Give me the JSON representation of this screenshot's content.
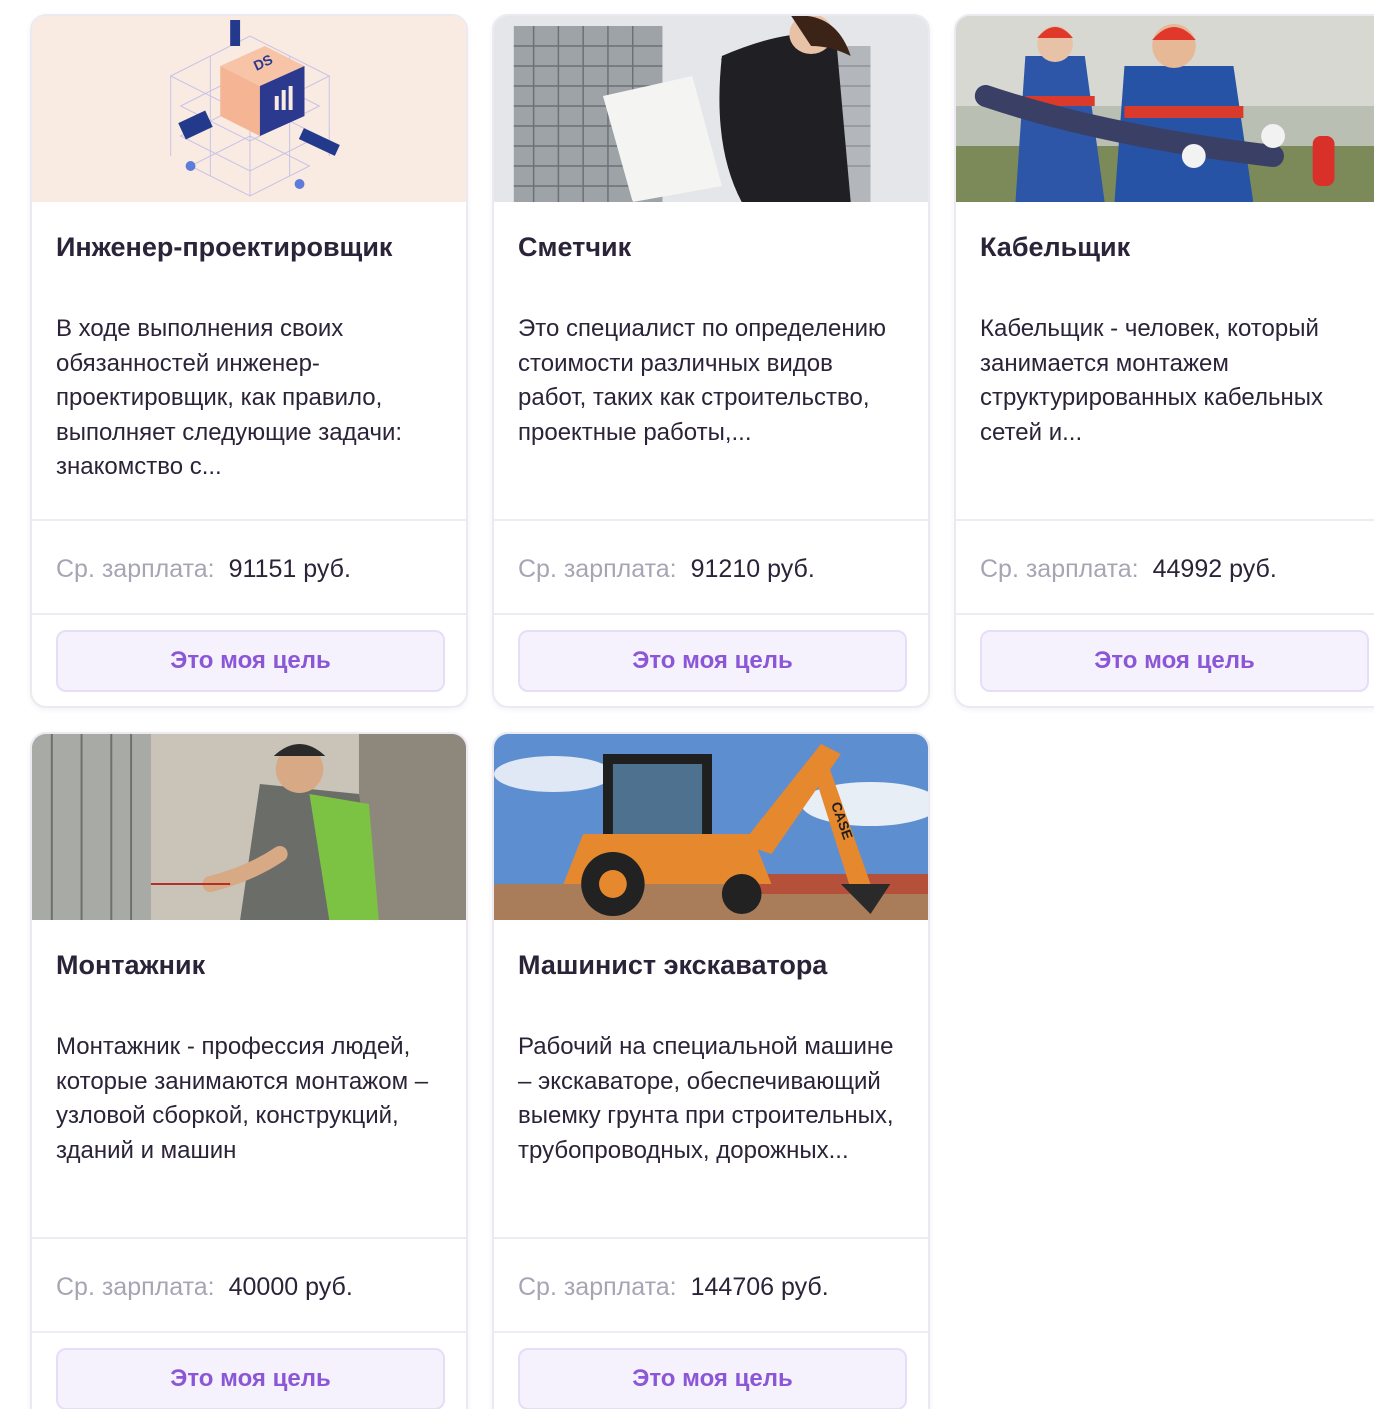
{
  "cards": [
    {
      "title": "Инженер-проектировщик",
      "description": "В ходе выполнения своих обязанностей инженер-проектировщик, как правило, выполняет следующие задачи: знакомство с...",
      "salary_label": "Ср. зарплата:",
      "salary_value": "91151 руб.",
      "button_label": "Это моя цель",
      "image_text": "DS"
    },
    {
      "title": "Сметчик",
      "description": "Это специалист по определению стоимости различных видов работ, таких как строительство, проектные работы,...",
      "salary_label": "Ср. зарплата:",
      "salary_value": "91210 руб.",
      "button_label": "Это моя цель"
    },
    {
      "title": "Кабельщик",
      "description": "Кабельщик - человек, который занимается монтажем структурированных кабельных сетей и...",
      "salary_label": "Ср. зарплата:",
      "salary_value": "44992 руб.",
      "button_label": "Это моя цель"
    },
    {
      "title": "Монтажник",
      "description": "Монтажник - профессия людей, которые занимаются монтажом – узловой сборкой, конструкций, зданий и машин",
      "salary_label": "Ср. зарплата:",
      "salary_value": "40000 руб.",
      "button_label": "Это моя цель"
    },
    {
      "title": "Машинист экскаватора",
      "description": "Рабочий на специальной машине – экскаваторе, обеспечивающий выемку грунта при строительных, трубопроводных, дорожных...",
      "salary_label": "Ср. зарплата:",
      "salary_value": "144706 руб.",
      "button_label": "Это моя цель",
      "image_text": "CASE"
    }
  ],
  "colors": {
    "accent": "#8b57d6",
    "button_bg": "#f5f1fd",
    "text": "#2b2338",
    "muted": "#a8a4b4"
  }
}
